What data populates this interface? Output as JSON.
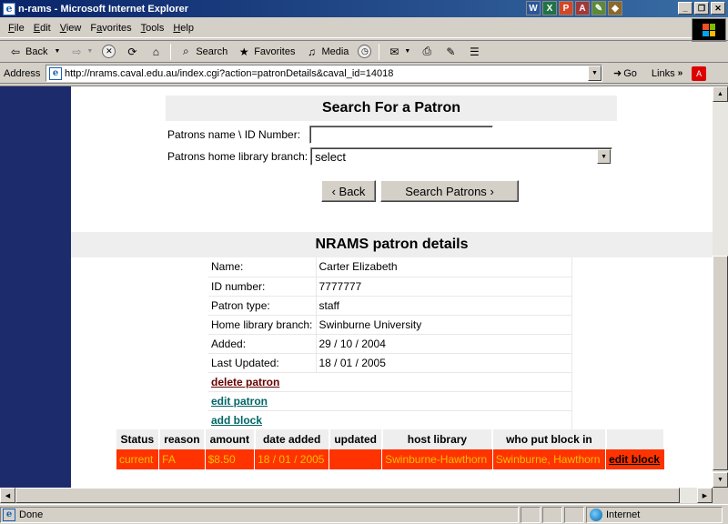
{
  "window": {
    "title": "n-rams - Microsoft Internet Explorer"
  },
  "taskbar_apps": [
    {
      "glyph": "W",
      "color": "#2b579a",
      "icon": "word-icon"
    },
    {
      "glyph": "X",
      "color": "#217346",
      "icon": "excel-icon"
    },
    {
      "glyph": "P",
      "color": "#d24726",
      "icon": "powerpoint-icon"
    },
    {
      "glyph": "A",
      "color": "#a4373a",
      "icon": "access-icon"
    },
    {
      "glyph": "✎",
      "color": "#5a8a3a",
      "icon": "publisher-icon"
    },
    {
      "glyph": "◆",
      "color": "#8a6a2a",
      "icon": "paint-icon"
    }
  ],
  "menu": {
    "file": {
      "key": "F",
      "rest": "ile"
    },
    "edit": {
      "key": "E",
      "rest": "dit"
    },
    "view": {
      "key": "V",
      "rest": "iew"
    },
    "favorites": {
      "key": "a",
      "pre": "F",
      "rest": "vorites"
    },
    "tools": {
      "key": "T",
      "rest": "ools"
    },
    "help": {
      "key": "H",
      "rest": "elp"
    }
  },
  "toolbar": {
    "back": "Back",
    "search": "Search",
    "favorites": "Favorites",
    "media": "Media"
  },
  "address": {
    "label": "Address",
    "url": "http://nrams.caval.edu.au/index.cgi?action=patronDetails&caval_id=14018",
    "go": "Go",
    "links": "Links"
  },
  "search_form": {
    "heading": "Search For a Patron",
    "name_label": "Patrons name \\ ID Number:",
    "name_value": "",
    "branch_label": "Patrons home library branch:",
    "branch_value": "select",
    "back_button": "Back",
    "search_button": "Search Patrons"
  },
  "patron_details": {
    "heading": "NRAMS patron details",
    "rows": [
      {
        "label": "Name:",
        "value": "Carter Elizabeth"
      },
      {
        "label": "ID number:",
        "value": "7777777"
      },
      {
        "label": "Patron type:",
        "value": "staff"
      },
      {
        "label": "Home library branch:",
        "value": "Swinburne University"
      },
      {
        "label": "Added:",
        "value": "29 / 10 / 2004"
      },
      {
        "label": "Last Updated:",
        "value": "18 / 01 / 2005"
      }
    ],
    "actions": {
      "delete": "delete patron",
      "edit": "edit patron",
      "add_block": "add block"
    }
  },
  "blocks": {
    "headers": [
      "Status",
      "reason",
      "amount",
      "date added",
      "updated",
      "host library",
      "who put block in",
      ""
    ],
    "rows": [
      {
        "status": "current",
        "reason": "FA",
        "amount": "$8.50",
        "date_added": "18 / 01 / 2005",
        "updated": "",
        "host_library": "Swinburne-Hawthorn",
        "who": "Swinburne, Hawthorn",
        "edit": "edit block"
      }
    ],
    "row_color": "#ff3300"
  },
  "status": {
    "text": "Done",
    "zone": "Internet"
  }
}
